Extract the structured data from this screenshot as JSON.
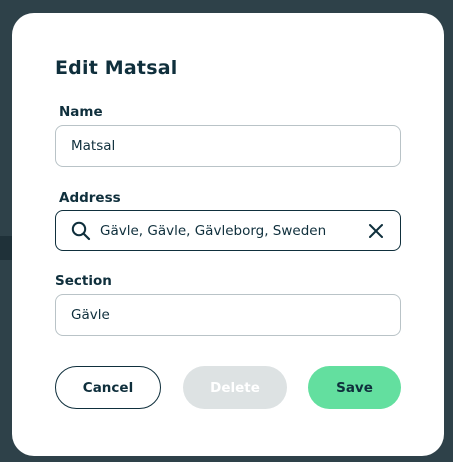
{
  "dialog": {
    "title": "Edit Matsal",
    "name_label": "Name",
    "name_value": "Matsal",
    "address_label": "Address",
    "address_value": "Gävle, Gävle, Gävleborg, Sweden",
    "section_label": "Section",
    "section_value": "Gävle",
    "cancel_label": "Cancel",
    "delete_label": "Delete",
    "save_label": "Save"
  },
  "icons": {
    "search": "search-icon",
    "clear": "close-icon"
  },
  "colors": {
    "primary_text": "#0f2f3c",
    "save_button": "#63df9f",
    "delete_button_disabled": "#dde2e3",
    "backdrop": "#2e4149"
  }
}
